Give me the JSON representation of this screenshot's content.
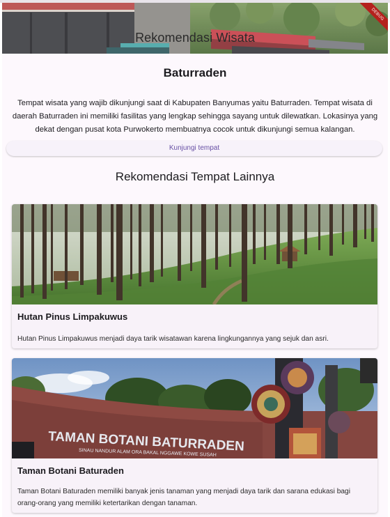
{
  "appbar": {
    "title": "Rekomendasi Wisata",
    "debug_banner": "DEBUG"
  },
  "main": {
    "title": "Baturraden",
    "description": "Tempat wisata yang wajib dikunjungi saat di Kabupaten Banyumas yaitu Baturraden. Tempat wisata di daerah Baturraden ini memiliki fasilitas yang lengkap sehingga sayang untuk dilewatkan. Lokasinya yang dekat dengan pusat kota Purwokerto membuatnya cocok untuk dikunjungi semua kalangan.",
    "button_label": "Kunjungi tempat"
  },
  "others": {
    "title": "Rekomendasi Tempat Lainnya",
    "cards": [
      {
        "title": "Hutan Pinus Limpakuwus",
        "description": "Hutan Pinus Limpakuwus menjadi daya tarik wisatawan karena lingkungannya yang sejuk dan asri."
      },
      {
        "title": "Taman Botani Baturaden",
        "description": "Taman Botani Baturaden memiliki banyak jenis tanaman yang menjadi daya tarik dan sarana edukasi bagi orang-orang yang memiliki ketertarikan dengan tanaman.",
        "sign_text": "TAMAN BOTANI BATURRADEN",
        "sign_subtext": "SINAU NANDUR ALAM ORA BAKAL NGGAWE KOWE SUSAH"
      }
    ]
  },
  "colors": {
    "background": "#fdf8fd",
    "button_text": "#6750a4",
    "debug_ribbon": "#b5211d"
  }
}
